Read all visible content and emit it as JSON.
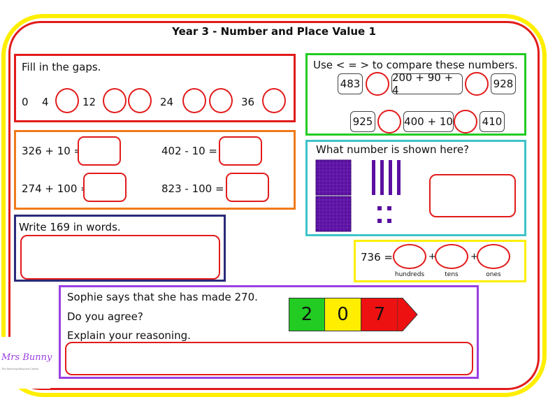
{
  "title": "Year 3 - Number and Place Value 1",
  "gaps": {
    "instruction": "Fill in the gaps.",
    "numbers": [
      "0",
      "4",
      "12",
      "24",
      "36"
    ]
  },
  "compare": {
    "instruction": "Use < = > to compare these numbers.",
    "row1": [
      "483",
      "200 + 90 + 4",
      "928"
    ],
    "row2": [
      "925",
      "400 + 10",
      "410"
    ]
  },
  "calc": {
    "q1": "326 + 10 =",
    "q2": "402 - 10 =",
    "q3": "274 + 100 =",
    "q4": "823 - 100 ="
  },
  "shown": {
    "question": "What number is shown here?",
    "hundreds": 2,
    "tens": 4,
    "ones": 4
  },
  "words": {
    "instruction": "Write 169 in words."
  },
  "partition": {
    "lead": "736 =",
    "plus": "+",
    "labels": [
      "hundreds",
      "tens",
      "ones"
    ]
  },
  "sophie": {
    "line1": "Sophie says that she has made 270.",
    "line2": "Do you agree?",
    "line3": "Explain your reasoning.",
    "digits": [
      "2",
      "0",
      "7"
    ],
    "colors": [
      "#22cc22",
      "#ffee00",
      "#ee1111",
      "#ee1111"
    ]
  },
  "logo": {
    "name": "Mrs Bunny",
    "tagline": "The Teaching Resource Centre"
  },
  "colors": {
    "red": "#e21b1b",
    "orange": "#f07a1a",
    "green": "#22cc22",
    "teal": "#3ec3c8",
    "navy": "#2a2a7a",
    "yellow": "#ffee00",
    "purple": "#9a3fe0",
    "base10": "#5b0fa0"
  }
}
